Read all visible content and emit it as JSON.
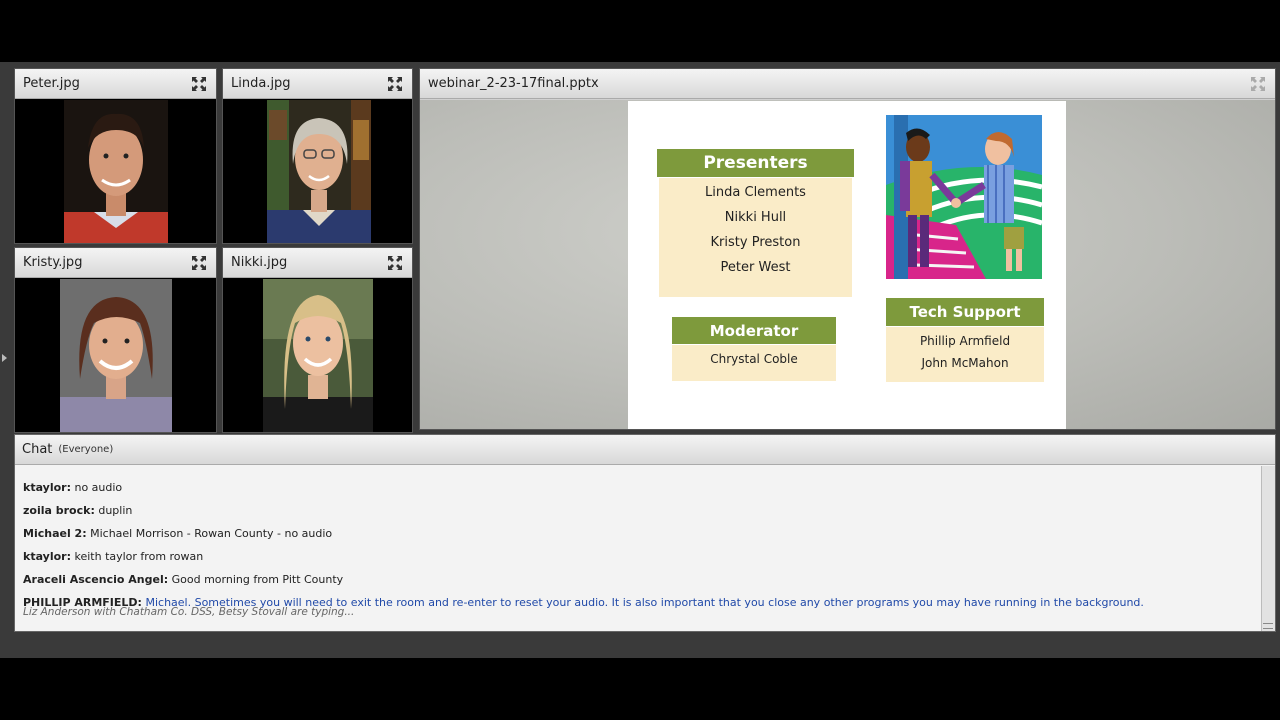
{
  "pods": [
    {
      "title": "Peter.jpg",
      "expand_icon": "expand-icon"
    },
    {
      "title": "Linda.jpg",
      "expand_icon": "expand-icon"
    },
    {
      "title": "Kristy.jpg",
      "expand_icon": "expand-icon"
    },
    {
      "title": "Nikki.jpg",
      "expand_icon": "expand-icon"
    }
  ],
  "share": {
    "title": "webinar_2-23-17final.pptx",
    "slide": {
      "presenters": {
        "heading": "Presenters",
        "names": [
          "Linda Clements",
          "Nikki Hull",
          "Kristy Preston",
          "Peter West"
        ]
      },
      "moderator": {
        "heading": "Moderator",
        "names": [
          "Chrystal Coble"
        ]
      },
      "tech_support": {
        "heading": "Tech Support",
        "names": [
          "Phillip Armfield",
          "John McMahon"
        ]
      }
    }
  },
  "chat": {
    "title": "Chat",
    "scope": "(Everyone)",
    "messages": [
      {
        "sender": "ktaylor:",
        "text": "no audio"
      },
      {
        "sender": "zoila brock:",
        "text": "duplin"
      },
      {
        "sender": "Michael 2:",
        "text": "Michael Morrison - Rowan County - no audio"
      },
      {
        "sender": "ktaylor:",
        "text": "keith taylor from rowan"
      },
      {
        "sender": "Araceli Ascencio Angel:",
        "text": "Good morning from Pitt County"
      },
      {
        "sender": "PHILLIP ARMFIELD:",
        "text": "Michael.  Sometimes you will need to exit the room and re-enter to reset your audio.  It is also important that you close any other programs you may have running in the background."
      }
    ],
    "typing": "Liz Anderson with Chatham Co. DSS, Betsy Stovall are typing..."
  },
  "colors": {
    "accent_green": "#7e9a3c",
    "box_fill": "#faecc8",
    "host_text": "#2049a8"
  }
}
